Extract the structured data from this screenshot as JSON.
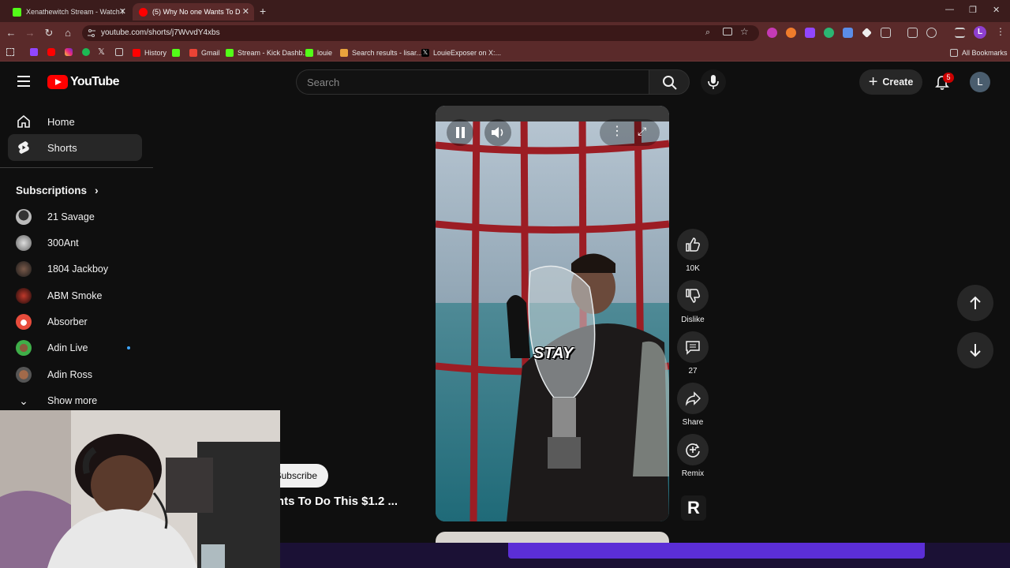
{
  "browser": {
    "tabs": [
      {
        "title": "Xenathewitch Stream - Watch l",
        "active": false
      },
      {
        "title": "(5) Why No one Wants To D",
        "active": true
      }
    ],
    "new_tab": "+",
    "url": "youtube.com/shorts/j7WvvdY4xbs",
    "bookmarks": [
      "History",
      "Gmail",
      "Stream - Kick Dashb...",
      "louie",
      "Search results - lisar...",
      "LouieExposer on X:..."
    ],
    "all_bookmarks": "All Bookmarks",
    "window_controls": [
      "—",
      "❐",
      "✕"
    ]
  },
  "youtube": {
    "logo_text": "YouTube",
    "search_placeholder": "Search",
    "create_label": "Create",
    "notification_count": "5",
    "avatar_letter": "L",
    "nav": [
      {
        "label": "Home",
        "icon": "home-icon"
      },
      {
        "label": "Shorts",
        "icon": "shorts-icon",
        "active": true
      }
    ],
    "subscriptions_title": "Subscriptions",
    "subscriptions": [
      "21 Savage",
      "300Ant",
      "1804 Jackboy",
      "ABM Smoke",
      "Absorber",
      "Adin Live",
      "Adin Ross"
    ],
    "show_more": "Show more",
    "short": {
      "caption": "STAY",
      "subscribe_label": "Subscribe",
      "title": "Why No one Wants To Do This $1.2 ..."
    },
    "actions": {
      "likes": "10K",
      "dislike": "Dislike",
      "comments": "27",
      "share": "Share",
      "remix": "Remix"
    },
    "colors": {
      "brand_red": "#ff0000",
      "accent_purple": "#5b2ed6"
    }
  }
}
